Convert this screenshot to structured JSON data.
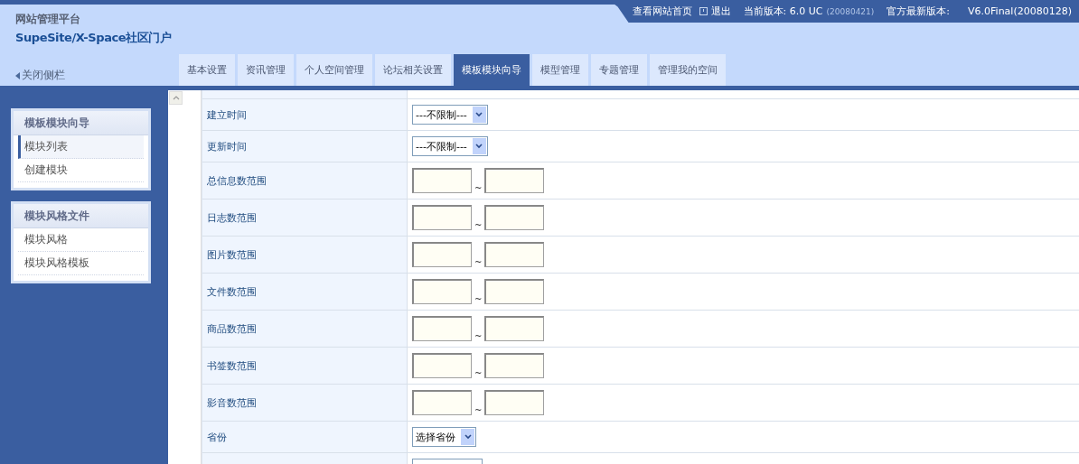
{
  "header": {
    "platform": "网站管理平台",
    "product": "SupeSite/X-Space社区门户",
    "close_sidebar": "关闭侧栏",
    "links": [
      {
        "kind": "link",
        "label": "查看网站首页"
      },
      {
        "kind": "logout",
        "label": "退出"
      }
    ],
    "version": {
      "label": "当前版本: 6.0 UC",
      "date": "(20080421)"
    },
    "latest": {
      "label": "官方最新版本:",
      "value": "V6.0Final(20080128)"
    }
  },
  "tabs": [
    {
      "label": "基本设置",
      "selected": false
    },
    {
      "label": "资讯管理",
      "selected": false
    },
    {
      "label": "个人空间管理",
      "selected": false
    },
    {
      "label": "论坛相关设置",
      "selected": false
    },
    {
      "label": "模板模块向导",
      "selected": true
    },
    {
      "label": "模型管理",
      "selected": false
    },
    {
      "label": "专题管理",
      "selected": false
    },
    {
      "label": "管理我的空间",
      "selected": false
    }
  ],
  "sidebar": [
    {
      "title": "模板模块向导",
      "items": [
        {
          "label": "模块列表",
          "selected": true
        },
        {
          "label": "创建模块",
          "selected": false
        }
      ]
    },
    {
      "title": "模块风格文件",
      "items": [
        {
          "label": "模块风格",
          "selected": false
        },
        {
          "label": "模块风格模板",
          "selected": false
        }
      ]
    }
  ],
  "form": {
    "rows": [
      {
        "kind": "select",
        "label": "建立时间",
        "value": "---不限制---"
      },
      {
        "kind": "select",
        "label": "更新时间",
        "value": "---不限制---"
      },
      {
        "kind": "range",
        "label": "总信息数范围",
        "separator": "~"
      },
      {
        "kind": "range",
        "label": "日志数范围",
        "separator": "~"
      },
      {
        "kind": "range",
        "label": "图片数范围",
        "separator": "~"
      },
      {
        "kind": "range",
        "label": "文件数范围",
        "separator": "~"
      },
      {
        "kind": "range",
        "label": "商品数范围",
        "separator": "~"
      },
      {
        "kind": "range",
        "label": "书签数范围",
        "separator": "~"
      },
      {
        "kind": "range",
        "label": "影音数范围",
        "separator": "~"
      },
      {
        "kind": "select",
        "label": "省份",
        "value": "选择省份"
      }
    ]
  }
}
